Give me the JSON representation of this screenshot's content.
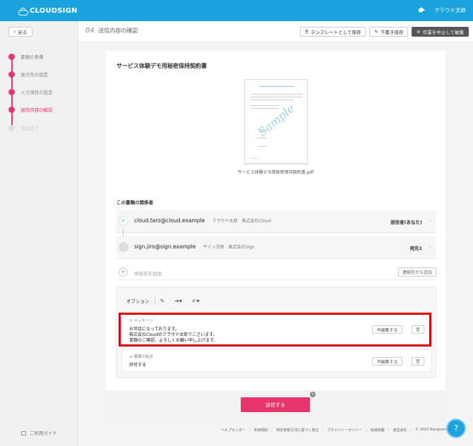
{
  "app": {
    "logo": "CLOUDSIGN",
    "user_name": "クラウド太郎"
  },
  "colors": {
    "brand": "#1aa3dc",
    "accent": "#e8356d",
    "highlight": "#d7000f"
  },
  "sidebar": {
    "back_label": "戻る",
    "steps": [
      {
        "label": "書類の準備",
        "state": "done"
      },
      {
        "label": "送付先の設定",
        "state": "done"
      },
      {
        "label": "入力項目の設定",
        "state": "done"
      },
      {
        "label": "送信内容の確認",
        "state": "current"
      },
      {
        "label": "送信完了",
        "state": "future"
      }
    ],
    "guide_label": "ご利用ガイド"
  },
  "header": {
    "step_number": "04",
    "title": "送信内容の確認",
    "save_template_label": "テンプレートとして保存",
    "save_draft_label": "下書き保存",
    "discard_label": "作業を中止して破棄"
  },
  "document": {
    "title": "サービス体験デモ用秘密保持契約書",
    "thumbnail_watermark": "Sample",
    "thumbnail_footer": "cloudsign",
    "file_name": "サービス体験デモ用秘密保持契約書.pdf"
  },
  "recipients": {
    "section_title": "この書類の関係者",
    "parties": [
      {
        "email": "cloud.taro@cloud.example",
        "name": "クラウド太郎　株式会社Cloud",
        "role": "送信者(あなた)"
      },
      {
        "email": "sign.jiro@sign.example",
        "name": "サイン次郎　株式会社Sign",
        "role": "宛先1"
      }
    ],
    "add_cc_label": "共有先を追加",
    "add_from_contacts_label": "連絡先から追加"
  },
  "options": {
    "label": "オプション",
    "message": {
      "header": "メッセージ",
      "lines": [
        "お世話になっております。",
        "株式会社Cloudのクラウド太郎でございます。",
        "書類のご確認、よろしくお願い申し上げます。"
      ],
      "edit_label": "編集する"
    },
    "transfer": {
      "header": "書類の転送",
      "value": "許可する",
      "edit_label": "編集する"
    }
  },
  "send_label": "送信する",
  "footer": {
    "links": [
      "ヘルプセンター",
      "利用規約",
      "特定商取引法に基づく表記",
      "プライバシーポリシー",
      "採用情報",
      "運営会社"
    ],
    "copyright": "© 2015 Bengoshi.com, Inc."
  }
}
